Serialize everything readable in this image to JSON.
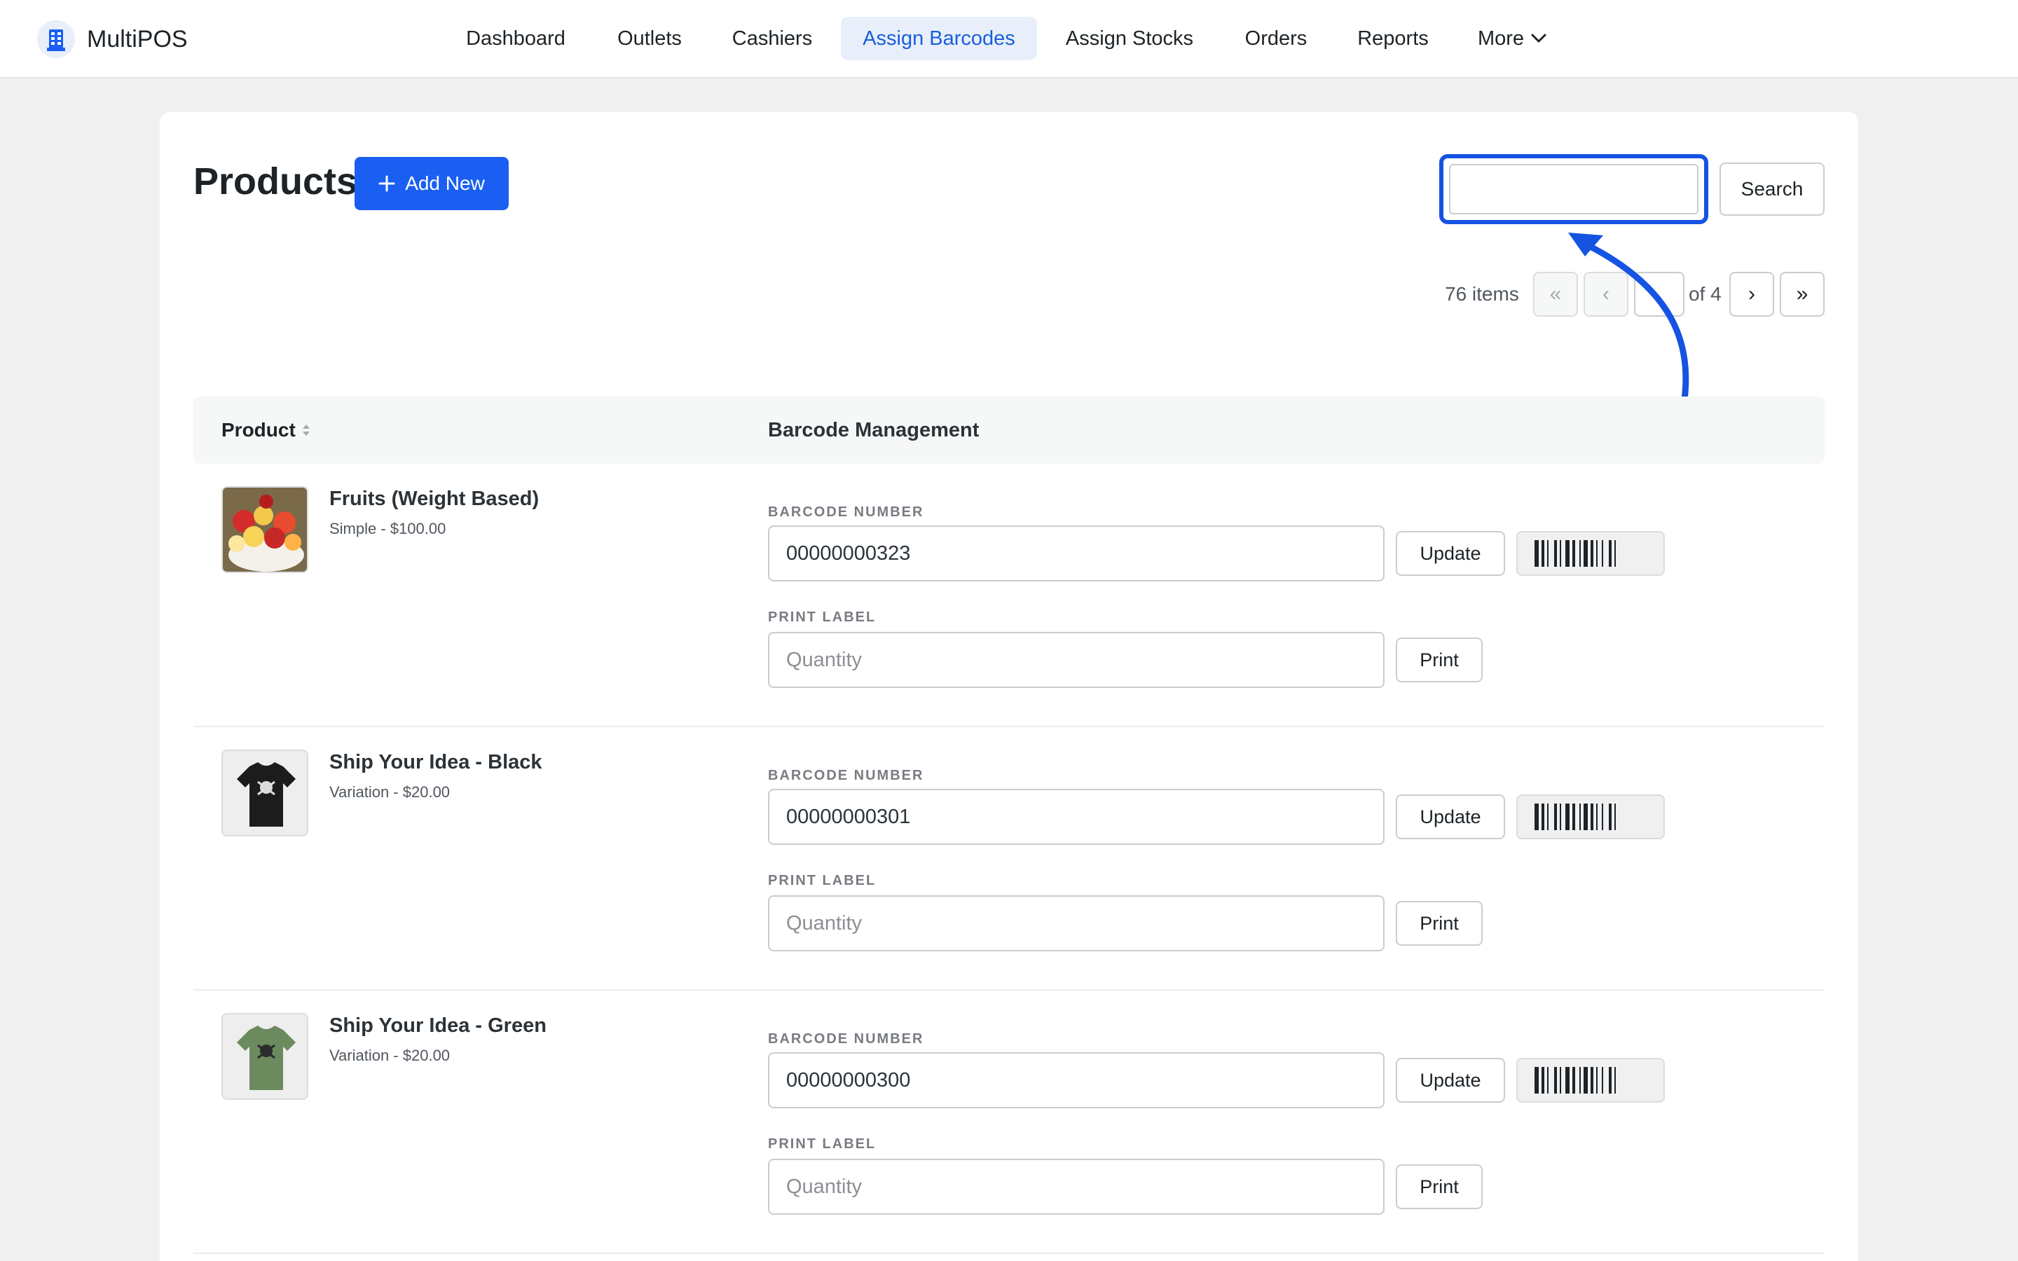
{
  "app": {
    "name": "MultiPOS",
    "logo_icon": "store-building-icon",
    "accent_color": "#1a5ff2"
  },
  "nav": {
    "items": [
      {
        "label": "Dashboard",
        "active": false
      },
      {
        "label": "Outlets",
        "active": false
      },
      {
        "label": "Cashiers",
        "active": false
      },
      {
        "label": "Assign Barcodes",
        "active": true
      },
      {
        "label": "Assign Stocks",
        "active": false
      },
      {
        "label": "Orders",
        "active": false
      },
      {
        "label": "Reports",
        "active": false
      }
    ],
    "more_label": "More",
    "more_icon": "chevron-down-icon"
  },
  "page": {
    "title": "Products",
    "add_new_label": "Add New",
    "add_icon": "plus-icon"
  },
  "search": {
    "value": "",
    "button_label": "Search"
  },
  "pagination": {
    "items_count": "76 items",
    "first_label": "«",
    "prev_label": "‹",
    "current_page": "",
    "of_total": "of 4",
    "next_label": "›",
    "last_label": "»"
  },
  "table": {
    "col_product": "Product",
    "col_barcode": "Barcode Management",
    "barcode_label": "BARCODE NUMBER",
    "print_label": "PRINT LABEL",
    "quantity_placeholder": "Quantity",
    "update_label": "Update",
    "print_button_label": "Print",
    "rows": [
      {
        "name": "Fruits (Weight Based)",
        "meta": "Simple - $100.00",
        "barcode": "00000000323",
        "thumb": "fruit-bowl-image"
      },
      {
        "name": "Ship Your Idea - Black",
        "meta": "Variation - $20.00",
        "barcode": "00000000301",
        "thumb": "black-tshirt-image"
      },
      {
        "name": "Ship Your Idea - Green",
        "meta": "Variation - $20.00",
        "barcode": "00000000300",
        "thumb": "green-tshirt-image"
      }
    ]
  }
}
